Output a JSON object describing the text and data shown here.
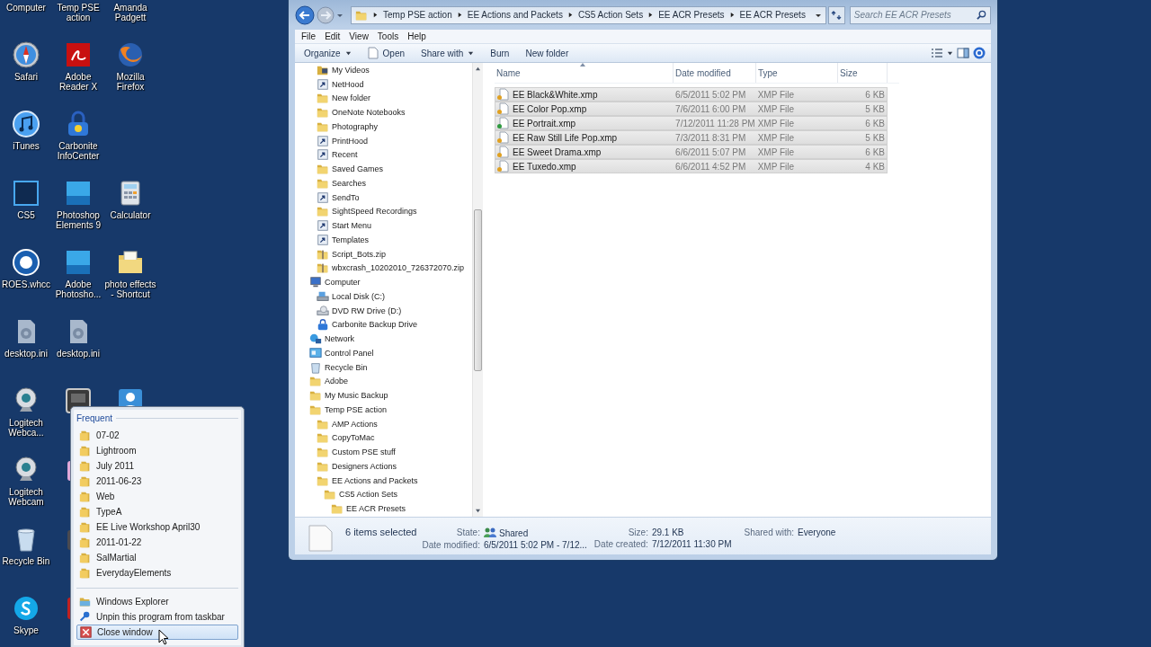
{
  "desktop": {
    "columns": [
      [
        {
          "label": "Computer",
          "kind": "hidden"
        },
        {
          "label": "Safari",
          "kind": "compass"
        },
        {
          "label": "iTunes",
          "kind": "music"
        },
        {
          "label": "CS5",
          "kind": "ps"
        },
        {
          "label": "ROES.whcc",
          "kind": "roes"
        },
        {
          "label": "desktop.ini",
          "kind": "inifile"
        },
        {
          "label": "Logitech Webca...",
          "kind": "webcam"
        },
        {
          "label": "Logitech Webcam",
          "kind": "webcam"
        },
        {
          "label": "Recycle Bin",
          "kind": "bin"
        },
        {
          "label": "Skype",
          "kind": "skype"
        }
      ],
      [
        {
          "label": "Temp PSE action",
          "kind": "hidden"
        },
        {
          "label": "Adobe Reader X",
          "kind": "pdf"
        },
        {
          "label": "Carbonite InfoCenter",
          "kind": "lock"
        },
        {
          "label": "Photoshop Elements 9",
          "kind": "pse"
        },
        {
          "label": "Adobe Photosho...",
          "kind": "pse"
        },
        {
          "label": "desktop.ini",
          "kind": "inifile"
        },
        {
          "kind": "film"
        },
        {
          "kind": "pink"
        },
        {
          "kind": "dark"
        },
        {
          "kind": "red"
        }
      ],
      [
        {
          "label": "Amanda Padgett",
          "kind": "hidden"
        },
        {
          "label": "Mozilla Firefox",
          "kind": "fox"
        },
        {
          "kind": "empty"
        },
        {
          "label": "Calculator",
          "kind": "calc"
        },
        {
          "label": "photo effects - Shortcut",
          "kind": "folderdoc"
        },
        {
          "kind": "empty"
        },
        {
          "kind": "person"
        }
      ]
    ]
  },
  "explorer": {
    "breadcrumb": [
      "Temp PSE action",
      "EE Actions and Packets",
      "CS5 Action Sets",
      "EE ACR Presets",
      "EE ACR Presets"
    ],
    "search": {
      "placeholder": "Search EE ACR Presets"
    },
    "menu": [
      "File",
      "Edit",
      "View",
      "Tools",
      "Help"
    ],
    "commands": [
      {
        "label": "Organize",
        "kind": "dropdown"
      },
      {
        "label": "Open",
        "kind": "icon"
      },
      {
        "label": "Share with",
        "kind": "dropdown"
      },
      {
        "label": "Burn",
        "kind": "plain"
      },
      {
        "label": "New folder",
        "kind": "plain"
      }
    ],
    "nav_pane": {
      "continued_items": [
        {
          "label": "My Videos",
          "kind": "video"
        },
        {
          "label": "NetHood",
          "kind": "shortcut"
        },
        {
          "label": "New folder",
          "kind": "folder"
        },
        {
          "label": "OneNote Notebooks",
          "kind": "folder"
        },
        {
          "label": "Photography",
          "kind": "folder"
        },
        {
          "label": "PrintHood",
          "kind": "shortcut"
        },
        {
          "label": "Recent",
          "kind": "shortcut"
        },
        {
          "label": "Saved Games",
          "kind": "folder"
        },
        {
          "label": "Searches",
          "kind": "folder"
        },
        {
          "label": "SendTo",
          "kind": "shortcut"
        },
        {
          "label": "SightSpeed Recordings",
          "kind": "folder"
        },
        {
          "label": "Start Menu",
          "kind": "shortcut"
        },
        {
          "label": "Templates",
          "kind": "shortcut"
        },
        {
          "label": "Script_Bots.zip",
          "kind": "zip"
        },
        {
          "label": "wbxcrash_10202010_726372070.zip",
          "kind": "zip"
        }
      ],
      "items": [
        {
          "label": "Computer",
          "kind": "computer",
          "children": [
            {
              "label": "Local Disk (C:)",
              "kind": "drive"
            },
            {
              "label": "DVD RW Drive (D:)",
              "kind": "dvd"
            },
            {
              "label": "Carbonite Backup Drive",
              "kind": "carbonite"
            }
          ]
        },
        {
          "label": "Network",
          "kind": "network"
        },
        {
          "label": "Control Panel",
          "kind": "panel"
        },
        {
          "label": "Recycle Bin",
          "kind": "bin"
        },
        {
          "label": "Adobe",
          "kind": "folder"
        },
        {
          "label": "My Music Backup",
          "kind": "folder"
        },
        {
          "label": "Temp PSE action",
          "kind": "folder",
          "children": [
            {
              "label": "AMP Actions",
              "kind": "folder"
            },
            {
              "label": "CopyToMac",
              "kind": "folder"
            },
            {
              "label": "Custom PSE stuff",
              "kind": "folder"
            },
            {
              "label": "Designers Actions",
              "kind": "folder"
            },
            {
              "label": "EE Actions and Packets",
              "kind": "folder",
              "children": [
                {
                  "label": "CS5 Action Sets",
                  "kind": "folder",
                  "children": [
                    {
                      "label": "EE ACR Presets",
                      "kind": "folder"
                    }
                  ]
                }
              ]
            }
          ]
        }
      ]
    },
    "file_list": {
      "columns": [
        "Name",
        "Date modified",
        "Type",
        "Size"
      ],
      "rows": [
        {
          "name": "EE Black&White.xmp",
          "date": "6/5/2011 5:02 PM",
          "type": "XMP File",
          "size": "6 KB",
          "selected": true,
          "color": "#e0a020"
        },
        {
          "name": "EE Color Pop.xmp",
          "date": "7/6/2011 6:00 PM",
          "type": "XMP File",
          "size": "5 KB",
          "selected": true,
          "color": "#e0a020"
        },
        {
          "name": "EE Portrait.xmp",
          "date": "7/12/2011 11:28 PM",
          "type": "XMP File",
          "size": "6 KB",
          "selected": true,
          "color": "#2e9a3e"
        },
        {
          "name": "EE Raw Still Life Pop.xmp",
          "date": "7/3/2011 8:31 PM",
          "type": "XMP File",
          "size": "5 KB",
          "selected": true,
          "color": "#e0a020"
        },
        {
          "name": "EE Sweet Drama.xmp",
          "date": "6/6/2011 5:07 PM",
          "type": "XMP File",
          "size": "6 KB",
          "selected": true,
          "color": "#e0a020"
        },
        {
          "name": "EE Tuxedo.xmp",
          "date": "6/6/2011 4:52 PM",
          "type": "XMP File",
          "size": "4 KB",
          "selected": true,
          "color": "#e0a020"
        }
      ]
    },
    "details": {
      "title": "6 items selected",
      "field_columns": [
        [
          {
            "label": "State:",
            "value": "Shared",
            "kind": "shared"
          },
          {
            "label": "Date modified:",
            "value": "6/5/2011 5:02 PM - 7/12..."
          }
        ],
        [
          {
            "label": "Size:",
            "value": "29.1 KB"
          },
          {
            "label": "Date created:",
            "value": "7/12/2011 11:30 PM"
          }
        ],
        [
          {
            "label": "Shared with:",
            "value": "Everyone"
          }
        ]
      ]
    }
  },
  "jump_list": {
    "heading": "Frequent",
    "items": [
      "07-02",
      "Lightroom",
      "July 2011",
      "2011-06-23",
      "Web",
      "TypeA",
      "EE Live Workshop April30",
      "2011-01-22",
      "SalMartial",
      "EverydayElements"
    ],
    "tasks": [
      {
        "label": "Windows Explorer",
        "kind": "explorer",
        "highlighted": false
      },
      {
        "label": "Unpin this program from taskbar",
        "kind": "unpin",
        "highlighted": false
      },
      {
        "label": "Close window",
        "kind": "close",
        "highlighted": true
      }
    ]
  }
}
